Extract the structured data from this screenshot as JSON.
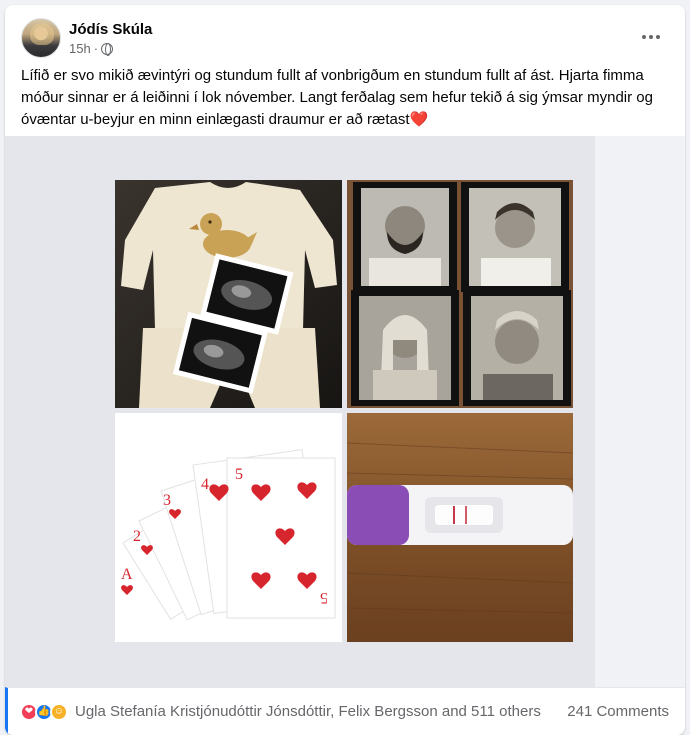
{
  "post": {
    "author": "Jódís Skúla",
    "time": "15h",
    "separator": "·",
    "text": "Lífið er svo mikið ævintýri og stundum fullt af vonbrigðum en stundum fullt af ást. Hjarta fimma móður sinnar er á leiðinni í lok nóvember. Langt ferðalag sem hefur tekið á sig ýmsar myndir og óvæntar u-beyjur en minn einlægasti draumur er að rætast",
    "text_emoji": "❤️"
  },
  "footer": {
    "reactions": [
      "love-icon",
      "like-icon",
      "care-icon"
    ],
    "reaction_names": "Ugla Stefanía Kristjónudóttir Jónsdóttir, Felix Bergsson and 511 others",
    "comments": "241 Comments"
  },
  "media": {
    "photos": [
      "baby-outfit-ultrasound",
      "family-portraits",
      "playing-cards-ace-to-five",
      "pregnancy-test"
    ]
  },
  "colors": {
    "accent": "#1877f2",
    "secondary_text": "#65676b"
  }
}
